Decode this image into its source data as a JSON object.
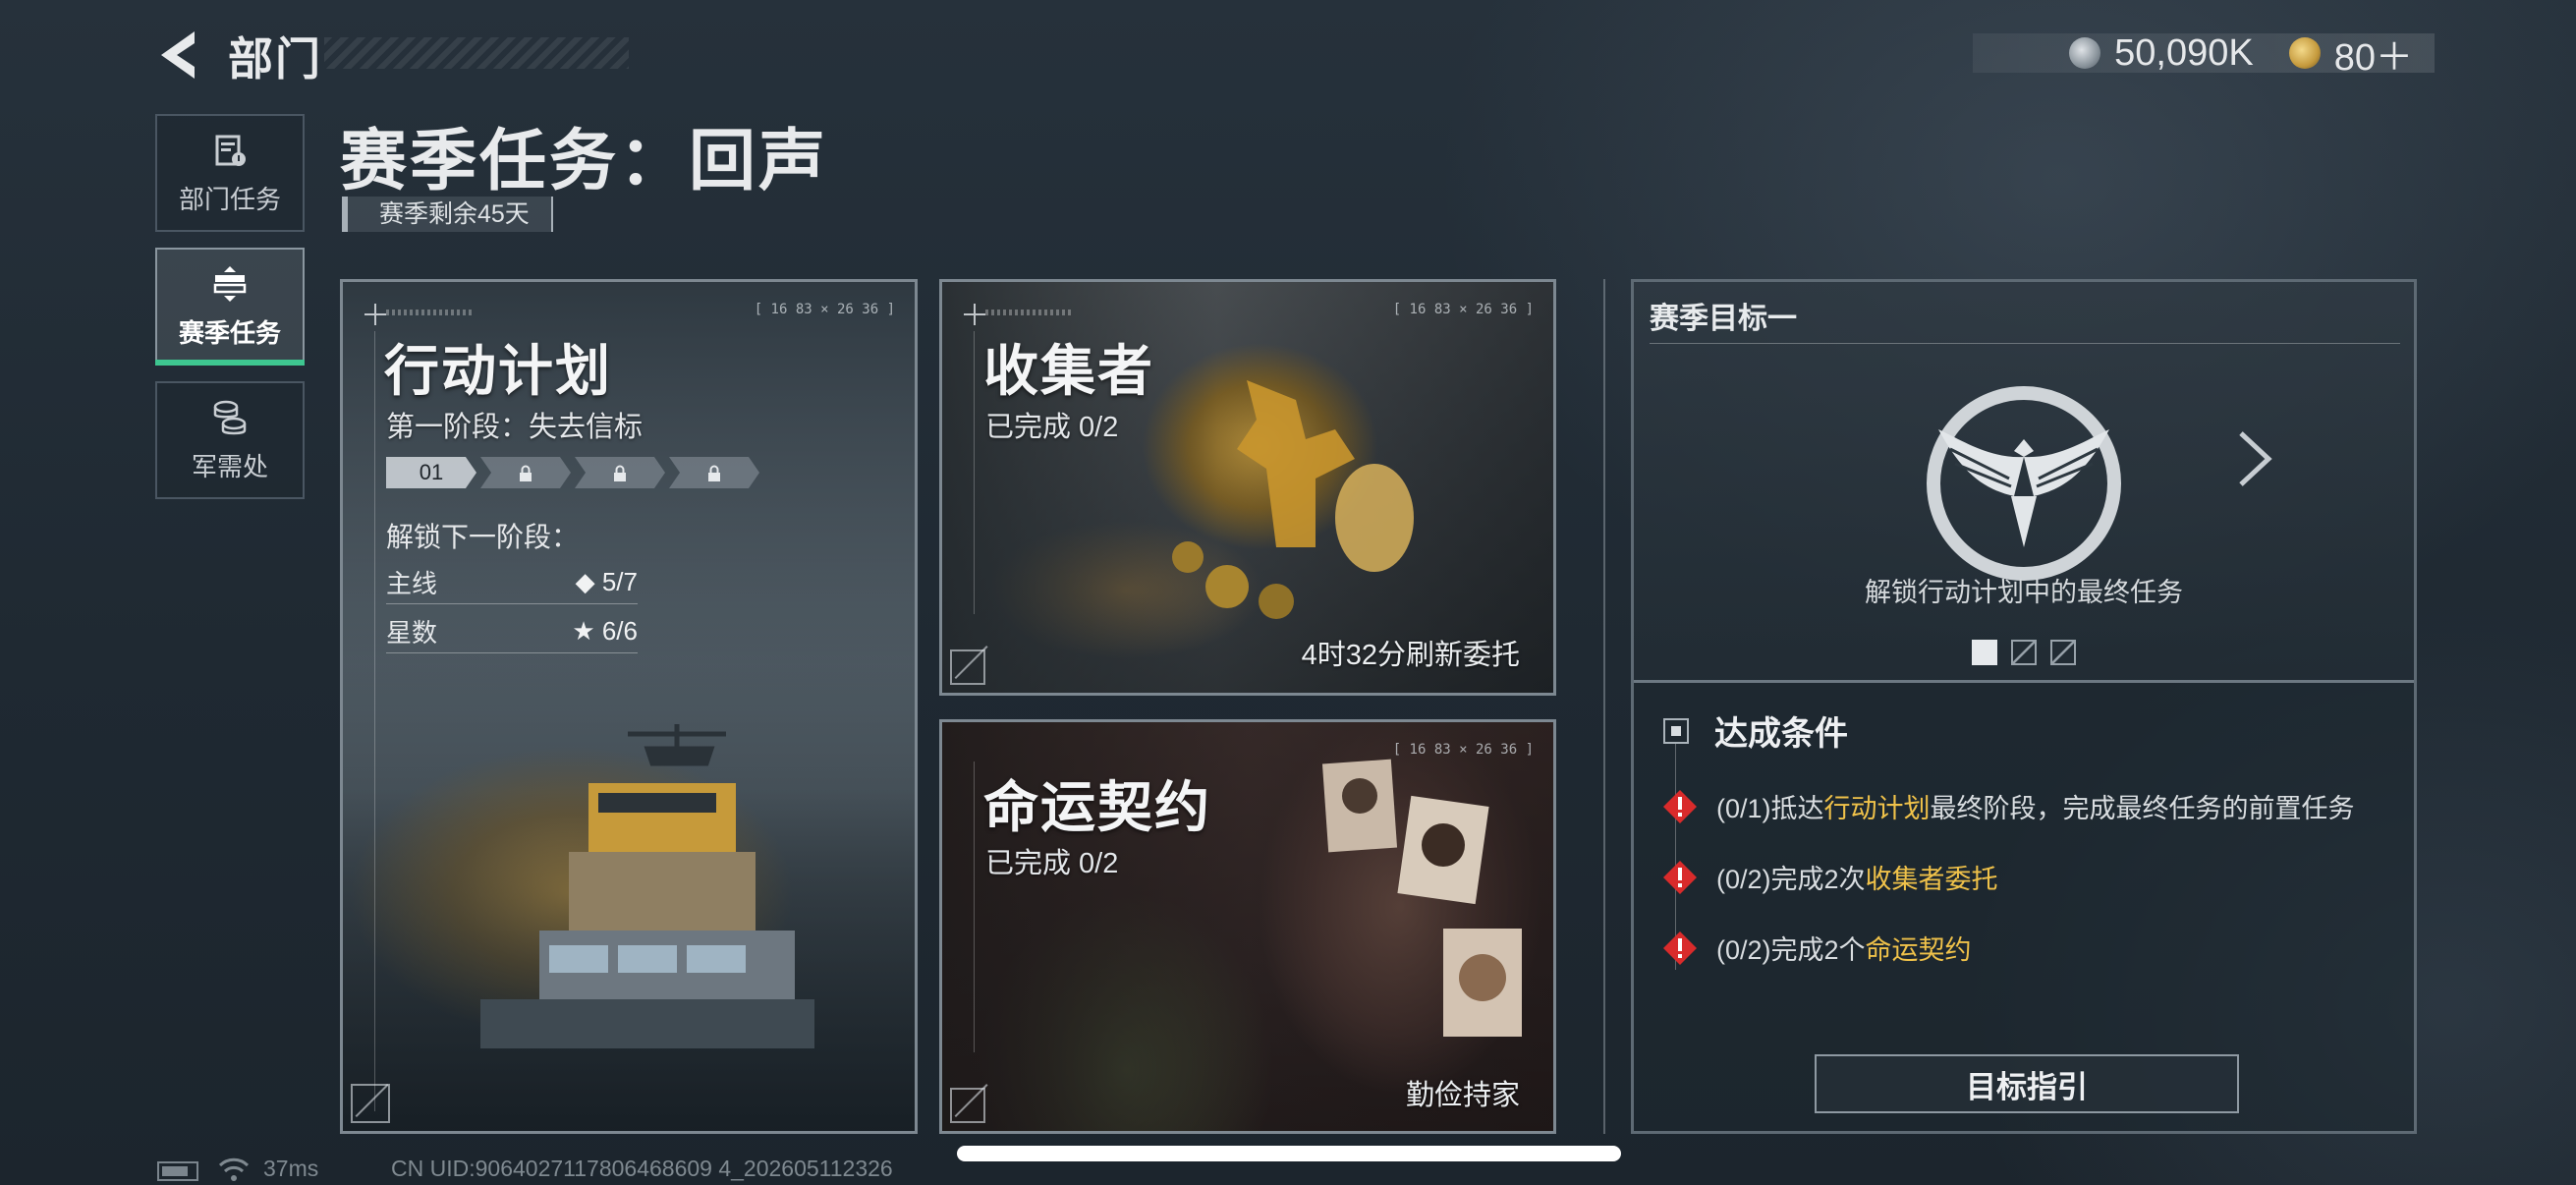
{
  "header": {
    "title": "部门"
  },
  "currency": [
    {
      "icon": "coin-icon",
      "value": "50,090K"
    },
    {
      "icon": "medal-icon",
      "value": "80＋"
    }
  ],
  "sidebar": {
    "items": [
      {
        "label": "部门任务",
        "icon": "clipboard-icon",
        "active": false
      },
      {
        "label": "赛季任务",
        "icon": "stack-icon",
        "active": true
      },
      {
        "label": "军需处",
        "icon": "coins-stack-icon",
        "active": false
      }
    ]
  },
  "season": {
    "title": "赛季任务：回声",
    "remaining": "赛季剩余45天"
  },
  "cards": {
    "action": {
      "title": "行动计划",
      "stage": "第一阶段：失去信标",
      "stages": [
        "01",
        "lock-icon",
        "lock-icon",
        "lock-icon"
      ],
      "unlock_label": "解锁下一阶段：",
      "stats": [
        {
          "label": "主线",
          "value": "◆ 5/7"
        },
        {
          "label": "星数",
          "value": "★ 6/6"
        }
      ],
      "coords": "[ 16 83 × 26 36 ]"
    },
    "collector": {
      "title": "收集者",
      "progress": "已完成 0/2",
      "footer": "4时32分刷新委托",
      "coords": "[ 16 83 × 26 36 ]"
    },
    "fate": {
      "title": "命运契约",
      "progress": "已完成 0/2",
      "footer": "勤俭持家",
      "coords": "[ 16 83 × 26 36 ]"
    }
  },
  "goal": {
    "title": "赛季目标一",
    "description": "解锁行动计划中的最终任务",
    "pages": 3,
    "active_page": 0,
    "conditions_title": "达成条件",
    "conditions": [
      {
        "pre": "(0/1)抵达",
        "hl": "行动计划",
        "post": "最终阶段，完成最终任务的前置任务"
      },
      {
        "pre": "(0/2)完成2次",
        "hl": "收集者委托",
        "post": ""
      },
      {
        "pre": "(0/2)完成2个",
        "hl": "命运契约",
        "post": ""
      }
    ],
    "guide_button": "目标指引"
  },
  "status": {
    "ping": "37ms",
    "uid": "CN UID:9064027117806468609 4_202605112326"
  },
  "colors": {
    "accent_green": "#3ec690",
    "highlight_gold": "#f0c24a",
    "warning_red": "#d92b2b"
  }
}
